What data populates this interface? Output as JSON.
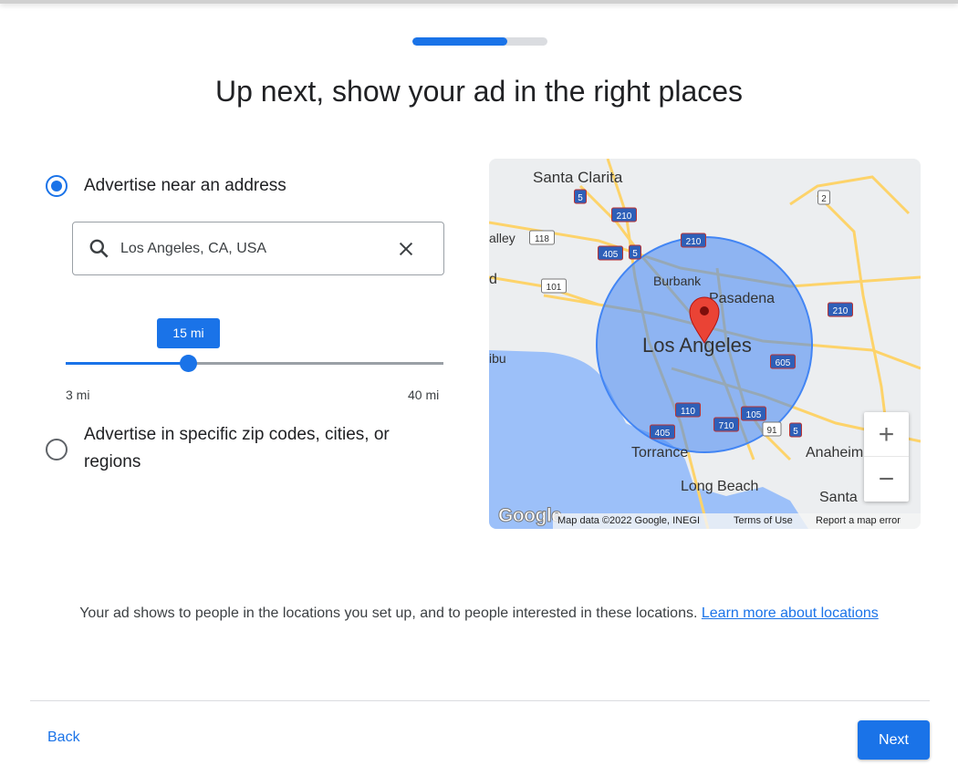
{
  "progress_percent": 70,
  "title": "Up next, show your ad in the right places",
  "options": [
    {
      "label": "Advertise near an address",
      "selected": true
    },
    {
      "label": "Advertise in specific zip codes, cities, or regions",
      "selected": false
    }
  ],
  "search": {
    "value": "Los Angeles, CA, USA",
    "icon": "search-icon",
    "clear_icon": "close-icon"
  },
  "radius": {
    "value": 15,
    "label": "15 mi",
    "min_label": "3 mi",
    "max_label": "40 mi",
    "min": 3,
    "max": 40
  },
  "map": {
    "labels": [
      "Santa Clarita",
      "Burbank",
      "Pasadena",
      "Los Angeles",
      "Torrance",
      "Anaheim",
      "Long Beach",
      "Santa",
      "alley",
      "d",
      "ibu"
    ],
    "shields": [
      "5",
      "210",
      "2",
      "118",
      "405",
      "5",
      "101",
      "210",
      "210",
      "605",
      "110",
      "405",
      "710",
      "105",
      "91",
      "5"
    ],
    "zoom_in": "+",
    "zoom_out": "−",
    "logo": "Google",
    "attribution": "Map data ©2022 Google, INEGI",
    "terms": "Terms of Use",
    "report": "Report a map error",
    "colors": {
      "circle": "#4285f4",
      "pin": "#ea4335",
      "water": "#9cc0f9",
      "road": "#fdd36a"
    }
  },
  "footnote": {
    "text": "Your ad shows to people in the locations you set up, and to people interested in these locations. ",
    "link": "Learn more about locations"
  },
  "buttons": {
    "back": "Back",
    "next": "Next"
  },
  "colors": {
    "accent": "#1a73e8"
  }
}
